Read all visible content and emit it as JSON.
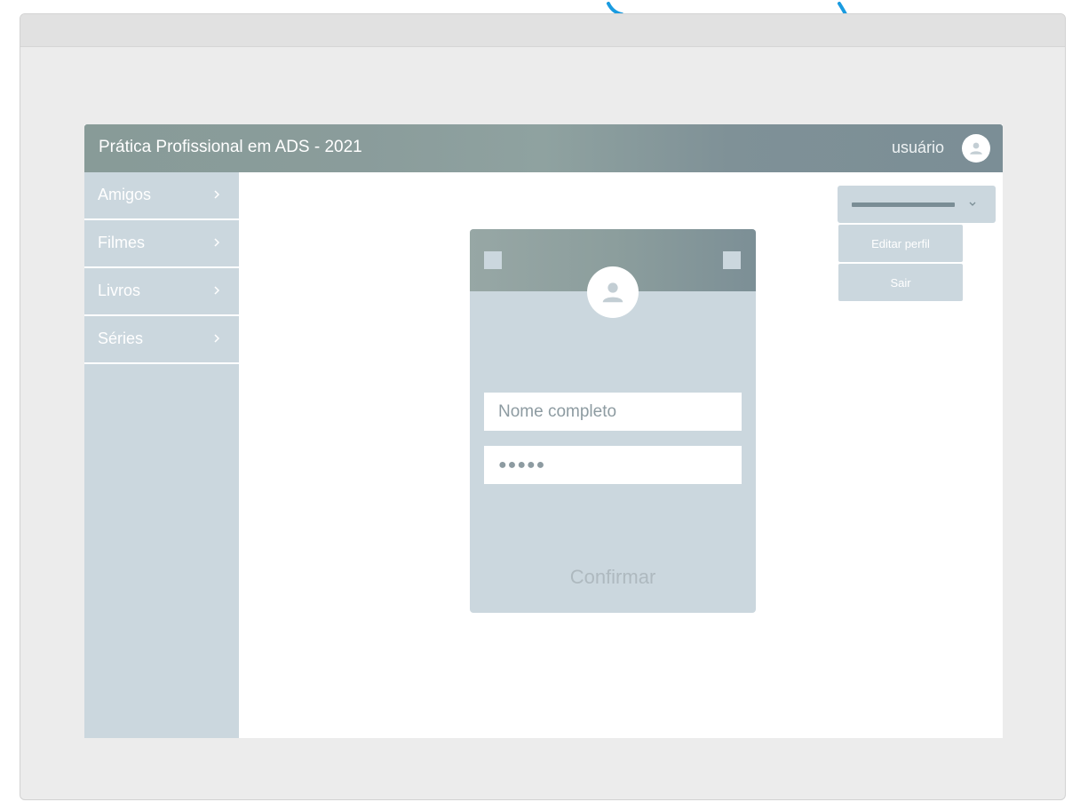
{
  "header": {
    "title": "Prática Profissional em ADS - 2021",
    "user_label": "usuário"
  },
  "sidebar": {
    "items": [
      {
        "label": "Amigos"
      },
      {
        "label": "Filmes"
      },
      {
        "label": "Livros"
      },
      {
        "label": "Séries"
      }
    ]
  },
  "dropdown": {
    "items": [
      {
        "label": "Editar perfil"
      },
      {
        "label": "Sair"
      }
    ]
  },
  "login_card": {
    "name_placeholder": "Nome completo",
    "password_value": "●●●●●",
    "confirm_label": "Confirmar"
  },
  "colors": {
    "header_gradient_start": "#889b98",
    "header_gradient_end": "#7b8e96",
    "panel": "#cbd7de",
    "frame_background": "#ececec",
    "accent_arc": "#1a9be0"
  },
  "icons": {
    "user_avatar": "user-icon",
    "sidebar_chevron": "chevron-right-icon",
    "dropdown_chevron": "chevron-down-icon"
  }
}
